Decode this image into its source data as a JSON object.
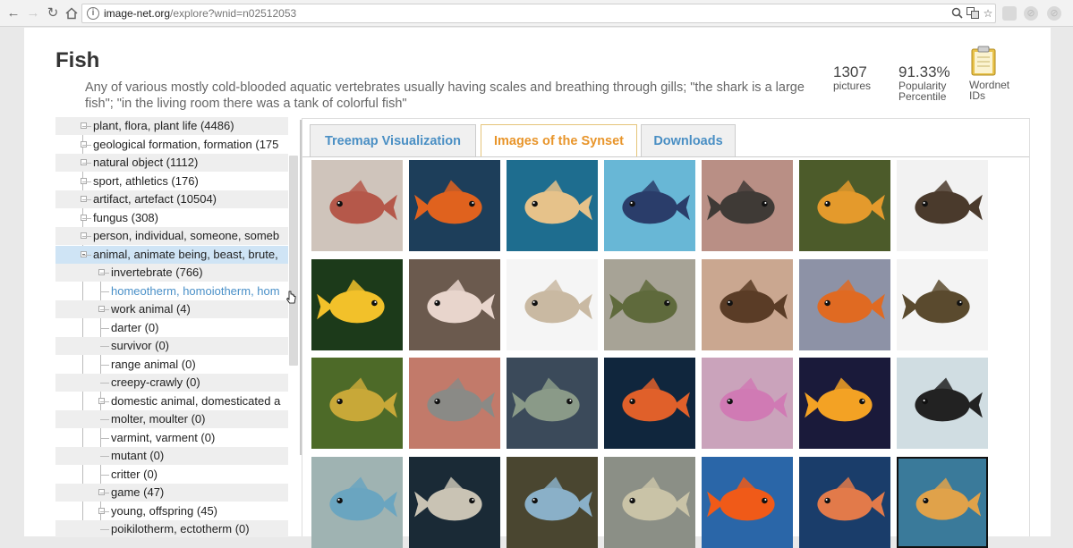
{
  "browser": {
    "url_host": "image-net.org",
    "url_path": "/explore?wnid=n02512053",
    "icons": [
      "back-icon",
      "forward-icon",
      "reload-icon",
      "home-icon",
      "info-icon",
      "zoom-icon",
      "translate-icon",
      "star-icon"
    ]
  },
  "header": {
    "title": "Fish",
    "gloss": "Any of various mostly cold-blooded aquatic vertebrates usually having scales and breathing through gills; \"the shark is a large fish\"; \"in the living room there was a tank of colorful fish\"",
    "pictures_count": "1307",
    "pictures_label": "pictures",
    "popularity_value": "91.33%",
    "popularity_label_1": "Popularity",
    "popularity_label_2": "Percentile",
    "wordnet_label_1": "Wordnet",
    "wordnet_label_2": "IDs"
  },
  "tree": {
    "items": [
      {
        "label": "plant, flora, plant life (4486)"
      },
      {
        "label": "geological formation, formation (175"
      },
      {
        "label": "natural object (1112)"
      },
      {
        "label": "sport, athletics (176)"
      },
      {
        "label": "artifact, artefact (10504)"
      },
      {
        "label": "fungus (308)"
      },
      {
        "label": "person, individual, someone, someb"
      },
      {
        "label": "animal, animate being, beast, brute,"
      },
      {
        "label": "invertebrate (766)"
      },
      {
        "label": "homeotherm, homoiotherm, hom"
      },
      {
        "label": "work animal (4)"
      },
      {
        "label": "darter (0)"
      },
      {
        "label": "survivor (0)"
      },
      {
        "label": "range animal (0)"
      },
      {
        "label": "creepy-crawly (0)"
      },
      {
        "label": "domestic animal, domesticated a"
      },
      {
        "label": "molter, moulter (0)"
      },
      {
        "label": "varmint, varment (0)"
      },
      {
        "label": "mutant (0)"
      },
      {
        "label": "critter (0)"
      },
      {
        "label": "game (47)"
      },
      {
        "label": "young, offspring (45)"
      },
      {
        "label": "poikilotherm, ectotherm (0)"
      }
    ]
  },
  "tabs": {
    "treemap": "Treemap Visualization",
    "images": "Images of the Synset",
    "downloads": "Downloads"
  },
  "gallery": {
    "images": [
      {
        "name": "red-squirrelfish",
        "bg": "#cfc4bb",
        "fish": "#b5584a"
      },
      {
        "name": "clownfish",
        "bg": "#1d3e5a",
        "fish": "#e0621e"
      },
      {
        "name": "underwater-fish",
        "bg": "#1e6d8f",
        "fish": "#e6c28a"
      },
      {
        "name": "emperor-angelfish",
        "bg": "#68b7d6",
        "fish": "#2a3d6a"
      },
      {
        "name": "fish-in-hand",
        "bg": "#b98f85",
        "fish": "#3f3a36"
      },
      {
        "name": "goldfish",
        "bg": "#4c5b2a",
        "fish": "#e49a2c"
      },
      {
        "name": "anglerfish",
        "bg": "#f2f2f2",
        "fish": "#4a3a2c"
      },
      {
        "name": "yellow-parrot-cichlid",
        "bg": "#1c3a1a",
        "fish": "#f2c12a"
      },
      {
        "name": "flowerhorn",
        "bg": "#6b5a4e",
        "fish": "#e8d5cc"
      },
      {
        "name": "striped-fish",
        "bg": "#f5f5f5",
        "fish": "#c9b9a2"
      },
      {
        "name": "bluegill",
        "bg": "#a7a396",
        "fish": "#5f6a3c"
      },
      {
        "name": "osprey",
        "bg": "#caa790",
        "fish": "#5a3c26"
      },
      {
        "name": "clownfish-anemone",
        "bg": "#8d92a6",
        "fish": "#e06a22"
      },
      {
        "name": "brown-fish",
        "bg": "#f4f4f4",
        "fish": "#5a4a2e"
      },
      {
        "name": "camouflaged-fish",
        "bg": "#4d6a28",
        "fish": "#c8a838"
      },
      {
        "name": "piranha-teeth",
        "bg": "#c27a6a",
        "fish": "#8a8a86"
      },
      {
        "name": "aquarium-rocks",
        "bg": "#3b4a5a",
        "fish": "#8a9a88"
      },
      {
        "name": "orange-fish",
        "bg": "#10263d",
        "fish": "#e0602a"
      },
      {
        "name": "pink-fish",
        "bg": "#caa3bb",
        "fish": "#d07ab4"
      },
      {
        "name": "golden-parrot-cichlid",
        "bg": "#1a1a3a",
        "fish": "#f3a224"
      },
      {
        "name": "catfish-silhouette",
        "bg": "#d0dde2",
        "fish": "#222222"
      },
      {
        "name": "flatfish",
        "bg": "#9fb3b2",
        "fish": "#6aa5c0"
      },
      {
        "name": "dark-water-fish",
        "bg": "#1a2a36",
        "fish": "#c9c3b4"
      },
      {
        "name": "blue-tang",
        "bg": "#4a4630",
        "fish": "#8ab0c8"
      },
      {
        "name": "grey-fish",
        "bg": "#8b8f86",
        "fish": "#c9c3a7"
      },
      {
        "name": "orange-goldfish",
        "bg": "#2a66a8",
        "fish": "#f05a18"
      },
      {
        "name": "orange-cichlid",
        "bg": "#1a3d6a",
        "fish": "#e27a4a"
      },
      {
        "name": "pufferfish",
        "bg": "#3a7a9a",
        "fish": "#e0a24a"
      }
    ]
  }
}
